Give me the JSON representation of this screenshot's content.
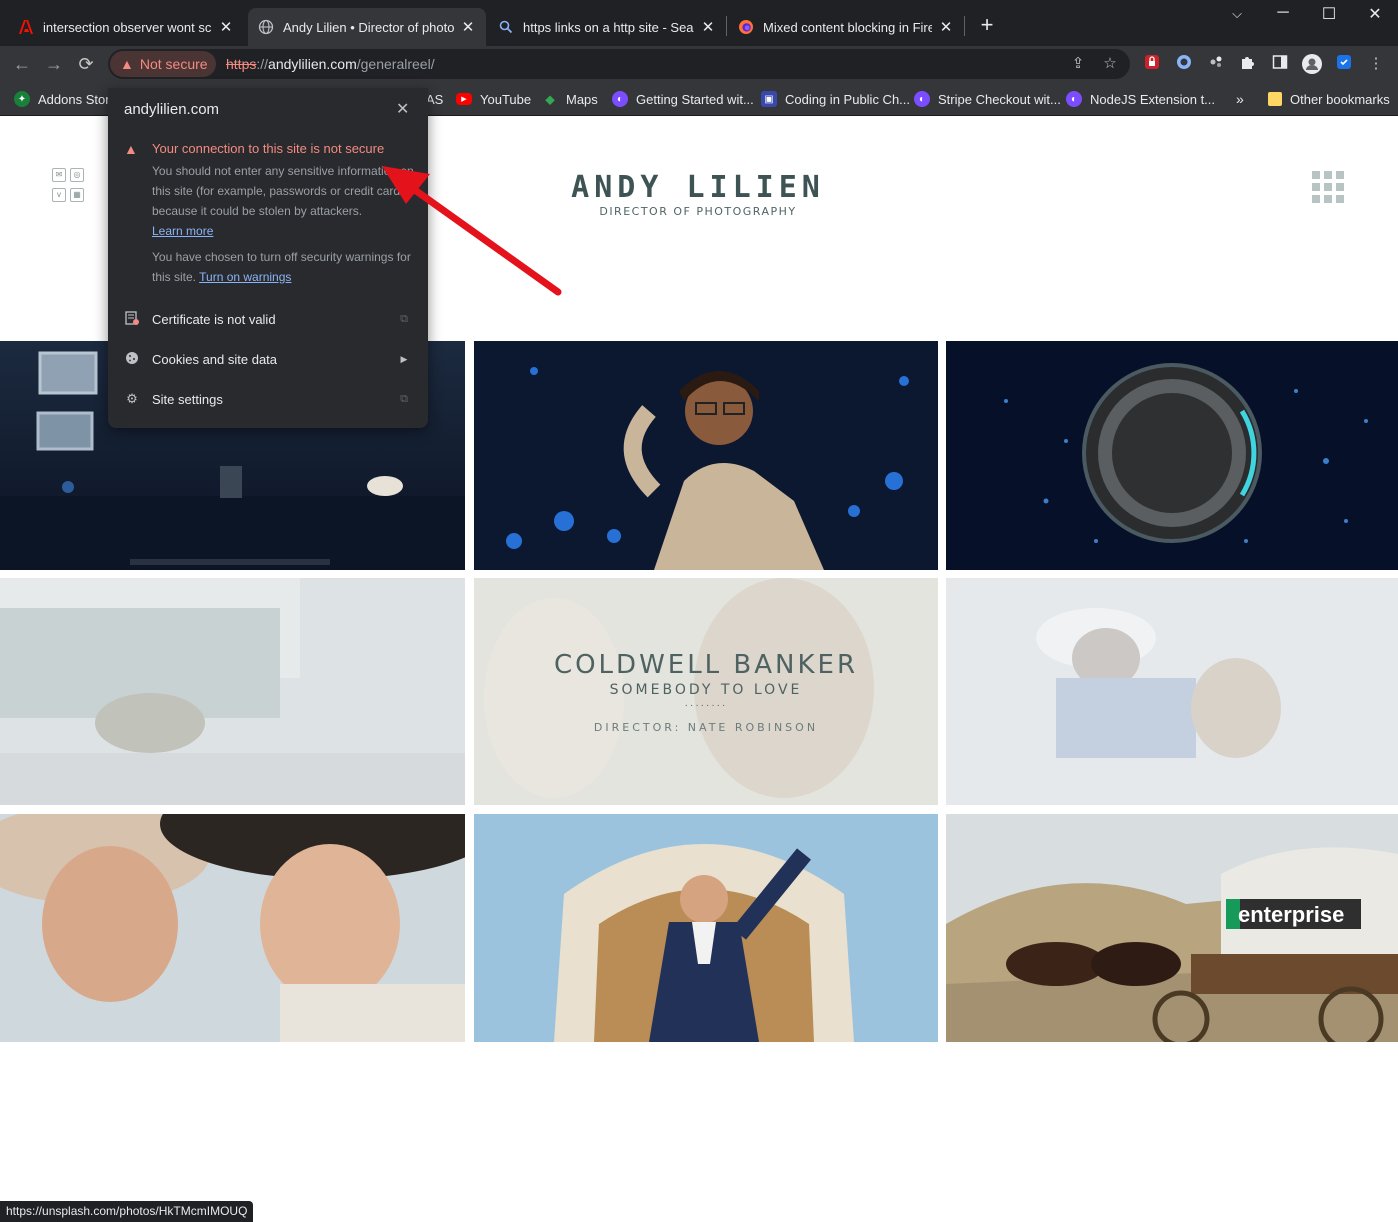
{
  "tabs": [
    {
      "title": "intersection observer wont scroll",
      "icon": "adobe-icon"
    },
    {
      "title": "Andy Lilien • Director of photography",
      "icon": "globe-icon",
      "active": true
    },
    {
      "title": "https links on a http site - Search",
      "icon": "search-icon"
    },
    {
      "title": "Mixed content blocking in Firefox",
      "icon": "firefox-icon"
    }
  ],
  "toolbar": {
    "security_label": "Not secure",
    "url_scheme": "https",
    "url_sep": "://",
    "url_host": "andylilien.com",
    "url_path": "/generalreel/"
  },
  "bookmarks": [
    {
      "label": "Addons Store",
      "color": "#188038"
    },
    {
      "label": "AS",
      "color": "#5f6368"
    },
    {
      "label": "YouTube",
      "color": "#ff0000"
    },
    {
      "label": "Maps",
      "color": "#34a853"
    },
    {
      "label": "Getting Started wit...",
      "color": "#7c4dff"
    },
    {
      "label": "Coding in Public Ch...",
      "color": "#3949ab"
    },
    {
      "label": "Stripe Checkout wit...",
      "color": "#7c4dff"
    },
    {
      "label": "NodeJS Extension t...",
      "color": "#7c4dff"
    },
    {
      "label": "Other bookmarks",
      "color": "#fdd663"
    }
  ],
  "site": {
    "logo_name": "ANDY LILIEN",
    "logo_sub": "DIRECTOR OF PHOTOGRAPHY",
    "overlay": {
      "title": "COLDWELL BANKER",
      "subtitle": "SOMEBODY TO LOVE",
      "dots": "········",
      "director": "DIRECTOR: NATE ROBINSON"
    },
    "enterprise_text": "enterprise"
  },
  "popup": {
    "host": "andylilien.com",
    "headline": "Your connection to this site is not secure",
    "body1": "You should not enter any sensitive information on this site (for example, passwords or credit cards), because it could be stolen by attackers.",
    "learn_more": "Learn more",
    "body2": "You have chosen to turn off security warnings for this site.",
    "turn_on": "Turn on warnings",
    "rows": [
      "Certificate is not valid",
      "Cookies and site data",
      "Site settings"
    ]
  },
  "status_url": "https://unsplash.com/photos/HkTMcmIMOUQ",
  "colors": {
    "chrome_dark": "#202124",
    "toolbar": "#35363a",
    "warning_red": "#f28b82",
    "link_blue": "#8ab4f8",
    "logo_teal": "#3e5454"
  }
}
